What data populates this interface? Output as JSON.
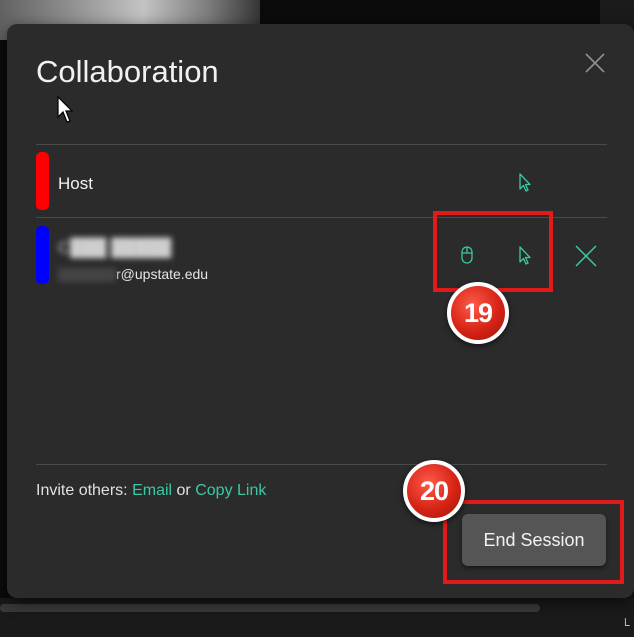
{
  "dialog": {
    "title": "Collaboration",
    "close_icon": "close-icon"
  },
  "participants": [
    {
      "name": "Host",
      "color": "#ff0000",
      "icons": [
        "pointer-icon"
      ]
    },
    {
      "name": "C███ █████",
      "email_visible": "r@upstate.edu",
      "color": "#0000ff",
      "icons": [
        "mouse-icon",
        "pointer-icon",
        "remove-icon"
      ]
    }
  ],
  "invite": {
    "prefix": "Invite others:",
    "email_link": "Email",
    "separator": "or",
    "copy_link": "Copy Link"
  },
  "end_session_label": "End Session",
  "annotations": [
    {
      "number": "19",
      "color": "#e31a1a"
    },
    {
      "number": "20",
      "color": "#e31a1a"
    }
  ],
  "colors": {
    "accent": "#3ac9a4",
    "dialog_bg": "#2b2b2b",
    "annotation": "#e31a1a"
  }
}
